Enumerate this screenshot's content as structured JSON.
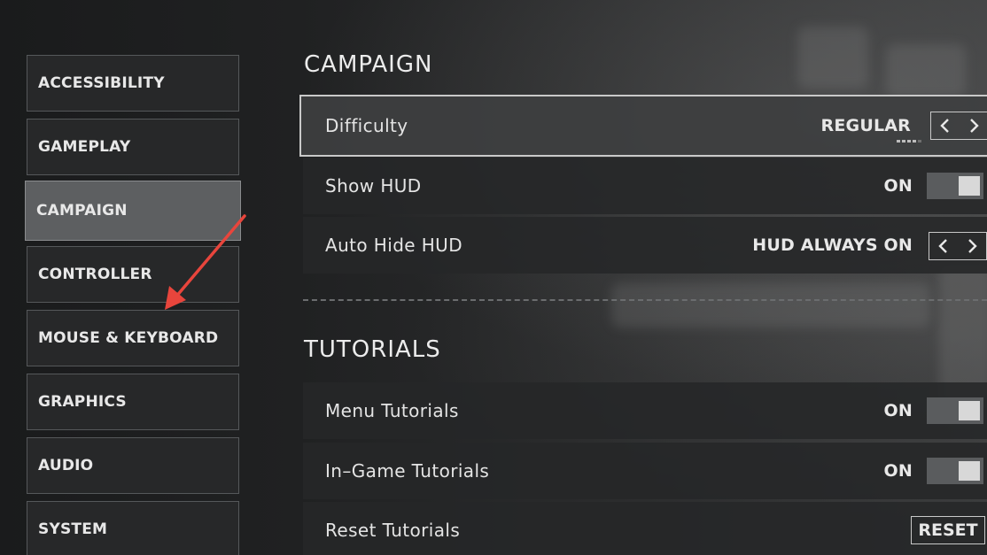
{
  "sidebar": {
    "items": [
      {
        "label": "ACCESSIBILITY"
      },
      {
        "label": "GAMEPLAY"
      },
      {
        "label": "CAMPAIGN"
      },
      {
        "label": "CONTROLLER"
      },
      {
        "label": "MOUSE & KEYBOARD"
      },
      {
        "label": "GRAPHICS"
      },
      {
        "label": "AUDIO"
      },
      {
        "label": "SYSTEM"
      }
    ],
    "active": "CAMPAIGN"
  },
  "campaign": {
    "title": "CAMPAIGN",
    "difficulty": {
      "label": "Difficulty",
      "value": "REGULAR"
    },
    "show_hud": {
      "label": "Show HUD",
      "value": "ON"
    },
    "auto_hide_hud": {
      "label": "Auto Hide HUD",
      "value": "HUD ALWAYS ON"
    }
  },
  "tutorials": {
    "title": "TUTORIALS",
    "menu_tutorials": {
      "label": "Menu Tutorials",
      "value": "ON"
    },
    "in_game_tutorials": {
      "label": "In–Game Tutorials",
      "value": "ON"
    },
    "reset_tutorials": {
      "label": "Reset Tutorials",
      "button": "RESET"
    }
  },
  "icons": {
    "prev": "chevron-left-icon",
    "next": "chevron-right-icon",
    "annotation": "red-arrow-annotation"
  },
  "colors": {
    "annotation": "#e8453c",
    "active_nav": "#5d5f61",
    "panel": "#262728"
  }
}
